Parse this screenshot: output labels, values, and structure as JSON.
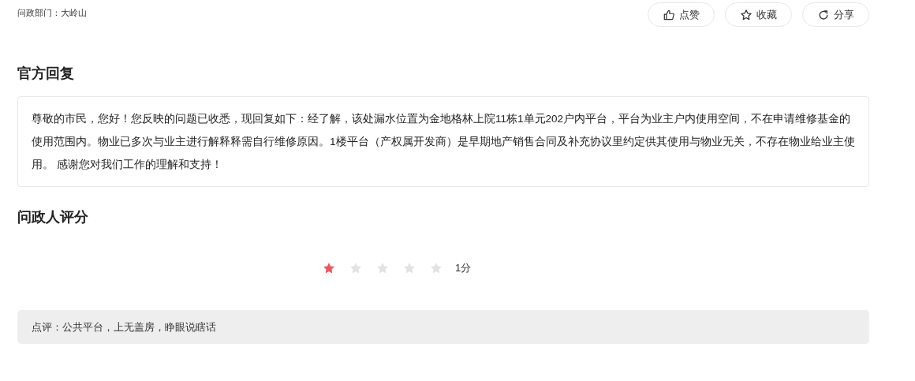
{
  "department": "问政部门：大岭山",
  "actions": [
    {
      "kind": "like",
      "label": "点赞"
    },
    {
      "kind": "favorite",
      "label": "收藏"
    },
    {
      "kind": "share",
      "label": "分享"
    }
  ],
  "official_reply": {
    "heading": "官方回复",
    "text": "尊敬的市民，您好！您反映的问题已收悉，现回复如下：经了解，该处漏水位置为金地格林上院11栋1单元202户内平台，平台为业主户内使用空间，不在申请维修基金的使用范围内。物业已多次与业主进行解释释需自行维修原因。1楼平台（产权属开发商）是早期地产销售合同及补充协议里约定供其使用与物业无关，不存在物业给业主使用。 感谢您对我们工作的理解和支持！"
  },
  "rating": {
    "heading": "问政人评分",
    "stars": 1,
    "score": "1分"
  },
  "comment": "点评：公共平台，上无盖房，睁眼说瞎话"
}
